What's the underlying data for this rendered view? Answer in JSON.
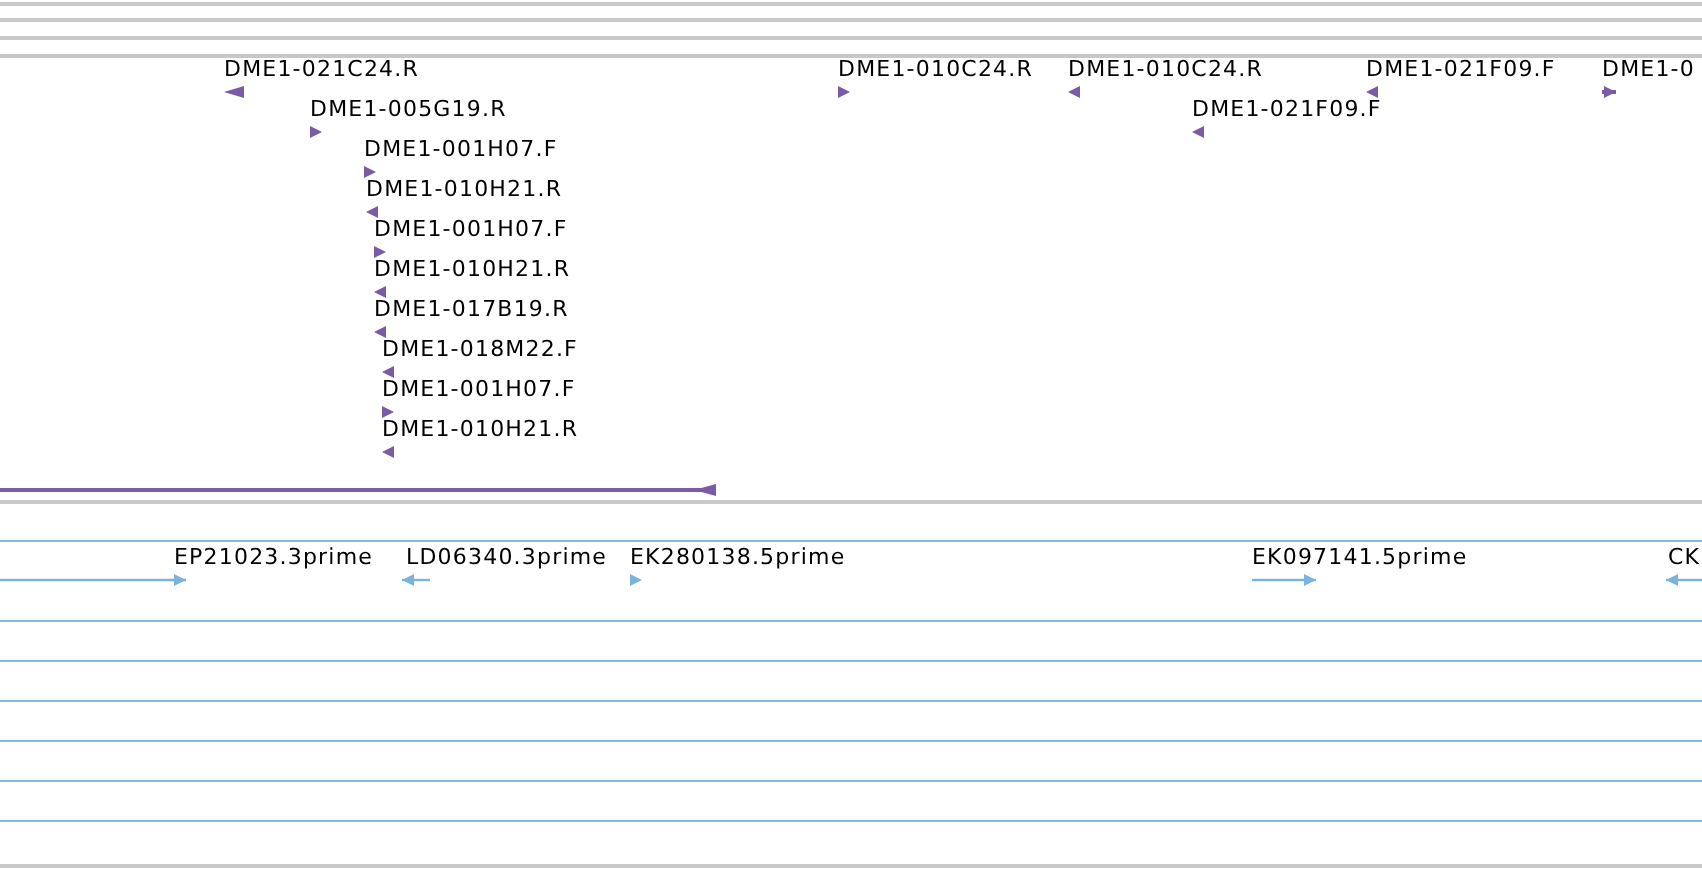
{
  "tracks": [
    {
      "kind": "alignment",
      "color": "#7b5aa6",
      "features": [
        {
          "label": "DME1-021C24.R",
          "reverse": true
        },
        {
          "label": "DME1-005G19.R",
          "reverse": false
        },
        {
          "label": "DME1-001H07.F",
          "reverse": false
        },
        {
          "label": "DME1-010H21.R",
          "reverse": true
        },
        {
          "label": "DME1-001H07.F",
          "reverse": false
        },
        {
          "label": "DME1-010H21.R",
          "reverse": true
        },
        {
          "label": "DME1-017B19.R",
          "reverse": true
        },
        {
          "label": "DME1-018M22.F",
          "reverse": true
        },
        {
          "label": "DME1-001H07.F",
          "reverse": false
        },
        {
          "label": "DME1-010H21.R",
          "reverse": true
        },
        {
          "label": "DME1-010C24.R",
          "reverse": false
        },
        {
          "label": "DME1-010C24.R",
          "reverse": true
        },
        {
          "label": "DME1-021F09.F",
          "reverse": true
        },
        {
          "label": "DME1-021F09.F",
          "reverse": true
        },
        {
          "label": "DME1-0",
          "reverse": false
        },
        {
          "reverse": true
        }
      ]
    },
    {
      "kind": "est",
      "color": "#7ab4de",
      "features": [
        {
          "label": "EP21023.3prime",
          "reverse": false
        },
        {
          "label": "LD06340.3prime",
          "reverse": true
        },
        {
          "label": "EK280138.5prime",
          "reverse": false
        },
        {
          "label": "EK097141.5prime",
          "reverse": false
        },
        {
          "label": "CK",
          "reverse": true
        }
      ]
    }
  ]
}
